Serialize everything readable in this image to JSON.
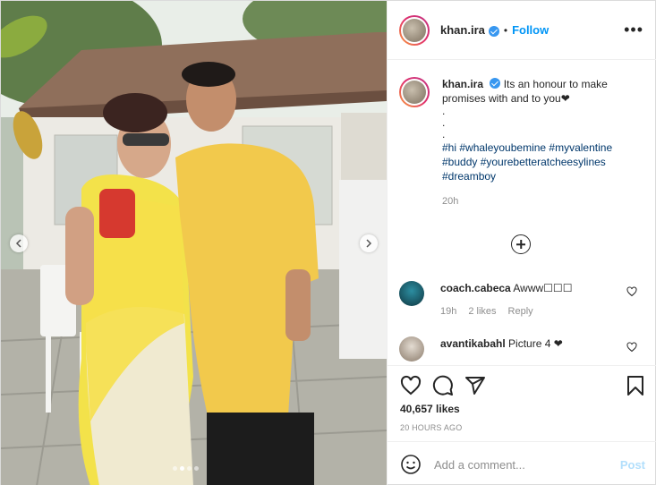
{
  "post": {
    "username": "khan.ira",
    "follow_label": "Follow",
    "separator": "•",
    "more_label": "•••"
  },
  "caption": {
    "username": "khan.ira",
    "text": "Its an honour to make promises with and to you❤",
    "dots": [
      ".",
      ".",
      "."
    ],
    "hashtags": "#hi #whaleyoubemine #myvalentine #buddy #yourebetteratcheesylines #dreamboy",
    "time": "20h"
  },
  "comments": [
    {
      "username": "coach.cabeca",
      "text": "Awww☐☐☐",
      "time": "19h",
      "likes": "2 likes",
      "reply": "Reply"
    },
    {
      "username": "avantikabahl",
      "text": "Picture 4 ❤"
    }
  ],
  "actions": {
    "likes": "40,657 likes",
    "ago": "20 HOURS AGO",
    "comment_placeholder": "Add a comment...",
    "post_label": "Post"
  },
  "carousel": {
    "slide_count": 4,
    "active_index": 1
  },
  "colors": {
    "link": "#0095f6",
    "hashtag": "#00376b",
    "muted": "#8e8e8e",
    "post_disabled": "#b2dffc"
  }
}
